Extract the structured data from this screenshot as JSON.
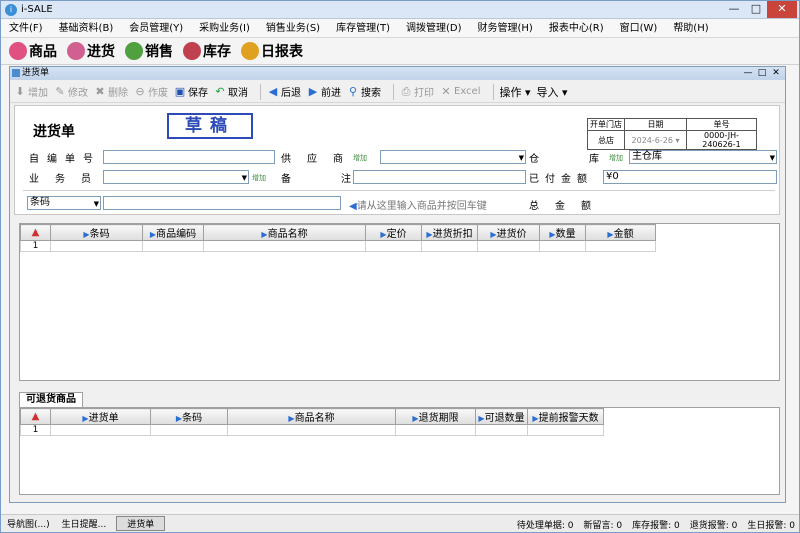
{
  "app": {
    "icon": "i",
    "title": "i-SALE",
    "min": "—",
    "max": "□",
    "close": "✕"
  },
  "menu": [
    "文件(F)",
    "基础资料(B)",
    "会员管理(Y)",
    "采购业务(I)",
    "销售业务(S)",
    "库存管理(T)",
    "调拨管理(D)",
    "财务管理(H)",
    "报表中心(R)",
    "窗口(W)",
    "帮助(H)"
  ],
  "quick": [
    {
      "label": "商品",
      "color": "#e05080"
    },
    {
      "label": "进货",
      "color": "#d06090"
    },
    {
      "label": "销售",
      "color": "#50a040"
    },
    {
      "label": "库存",
      "color": "#c04050"
    },
    {
      "label": "日报表",
      "color": "#e0a020"
    }
  ],
  "child": {
    "title": "进货单",
    "min": "—",
    "max": "□",
    "close": "✕"
  },
  "toolbar": {
    "add": "增加",
    "edit": "修改",
    "delete": "删除",
    "void": "作废",
    "save": "保存",
    "cancel": "取消",
    "back": "后退",
    "forward": "前进",
    "search": "搜索",
    "print": "打印",
    "excel": "Excel",
    "ops": "操作 ▾",
    "import": "导入 ▾"
  },
  "form": {
    "title": "进货单",
    "stamp": "草稿",
    "hdr": {
      "c1": "开单门店",
      "c2": "日期",
      "c3": "单号",
      "v1": "总店",
      "v2": "2024-6-26 ▾",
      "v3": "0000-JH-240626-1"
    },
    "self_no": "自编单号",
    "supplier": "供应商",
    "warehouse": "仓库",
    "warehouse_val": "主仓库",
    "clerk": "业务员",
    "note": "备注",
    "paid": "已付金额",
    "paid_val": "¥0",
    "add_tag": "增加",
    "barcode": "条码",
    "hint": "请从这里输入商品并按回车键",
    "total": "总金额"
  },
  "grid1": {
    "cols": [
      "条码",
      "商品编码",
      "商品名称",
      "定价",
      "进货折扣",
      "进货价",
      "数量",
      "金额"
    ],
    "row": "1"
  },
  "tab": "可退货商品",
  "grid2": {
    "cols": [
      "进货单",
      "条码",
      "商品名称",
      "退货期限",
      "可退数量",
      "提前报警天数"
    ],
    "row": "1"
  },
  "status": {
    "nav": "导航图(...)",
    "birthday": "生日提醒...",
    "current": "进货单",
    "pending": "待处理单据: 0",
    "msgs": "新留言: 0",
    "stock": "库存报警: 0",
    "return": "退货报警: 0",
    "bday": "生日报警: 0"
  }
}
